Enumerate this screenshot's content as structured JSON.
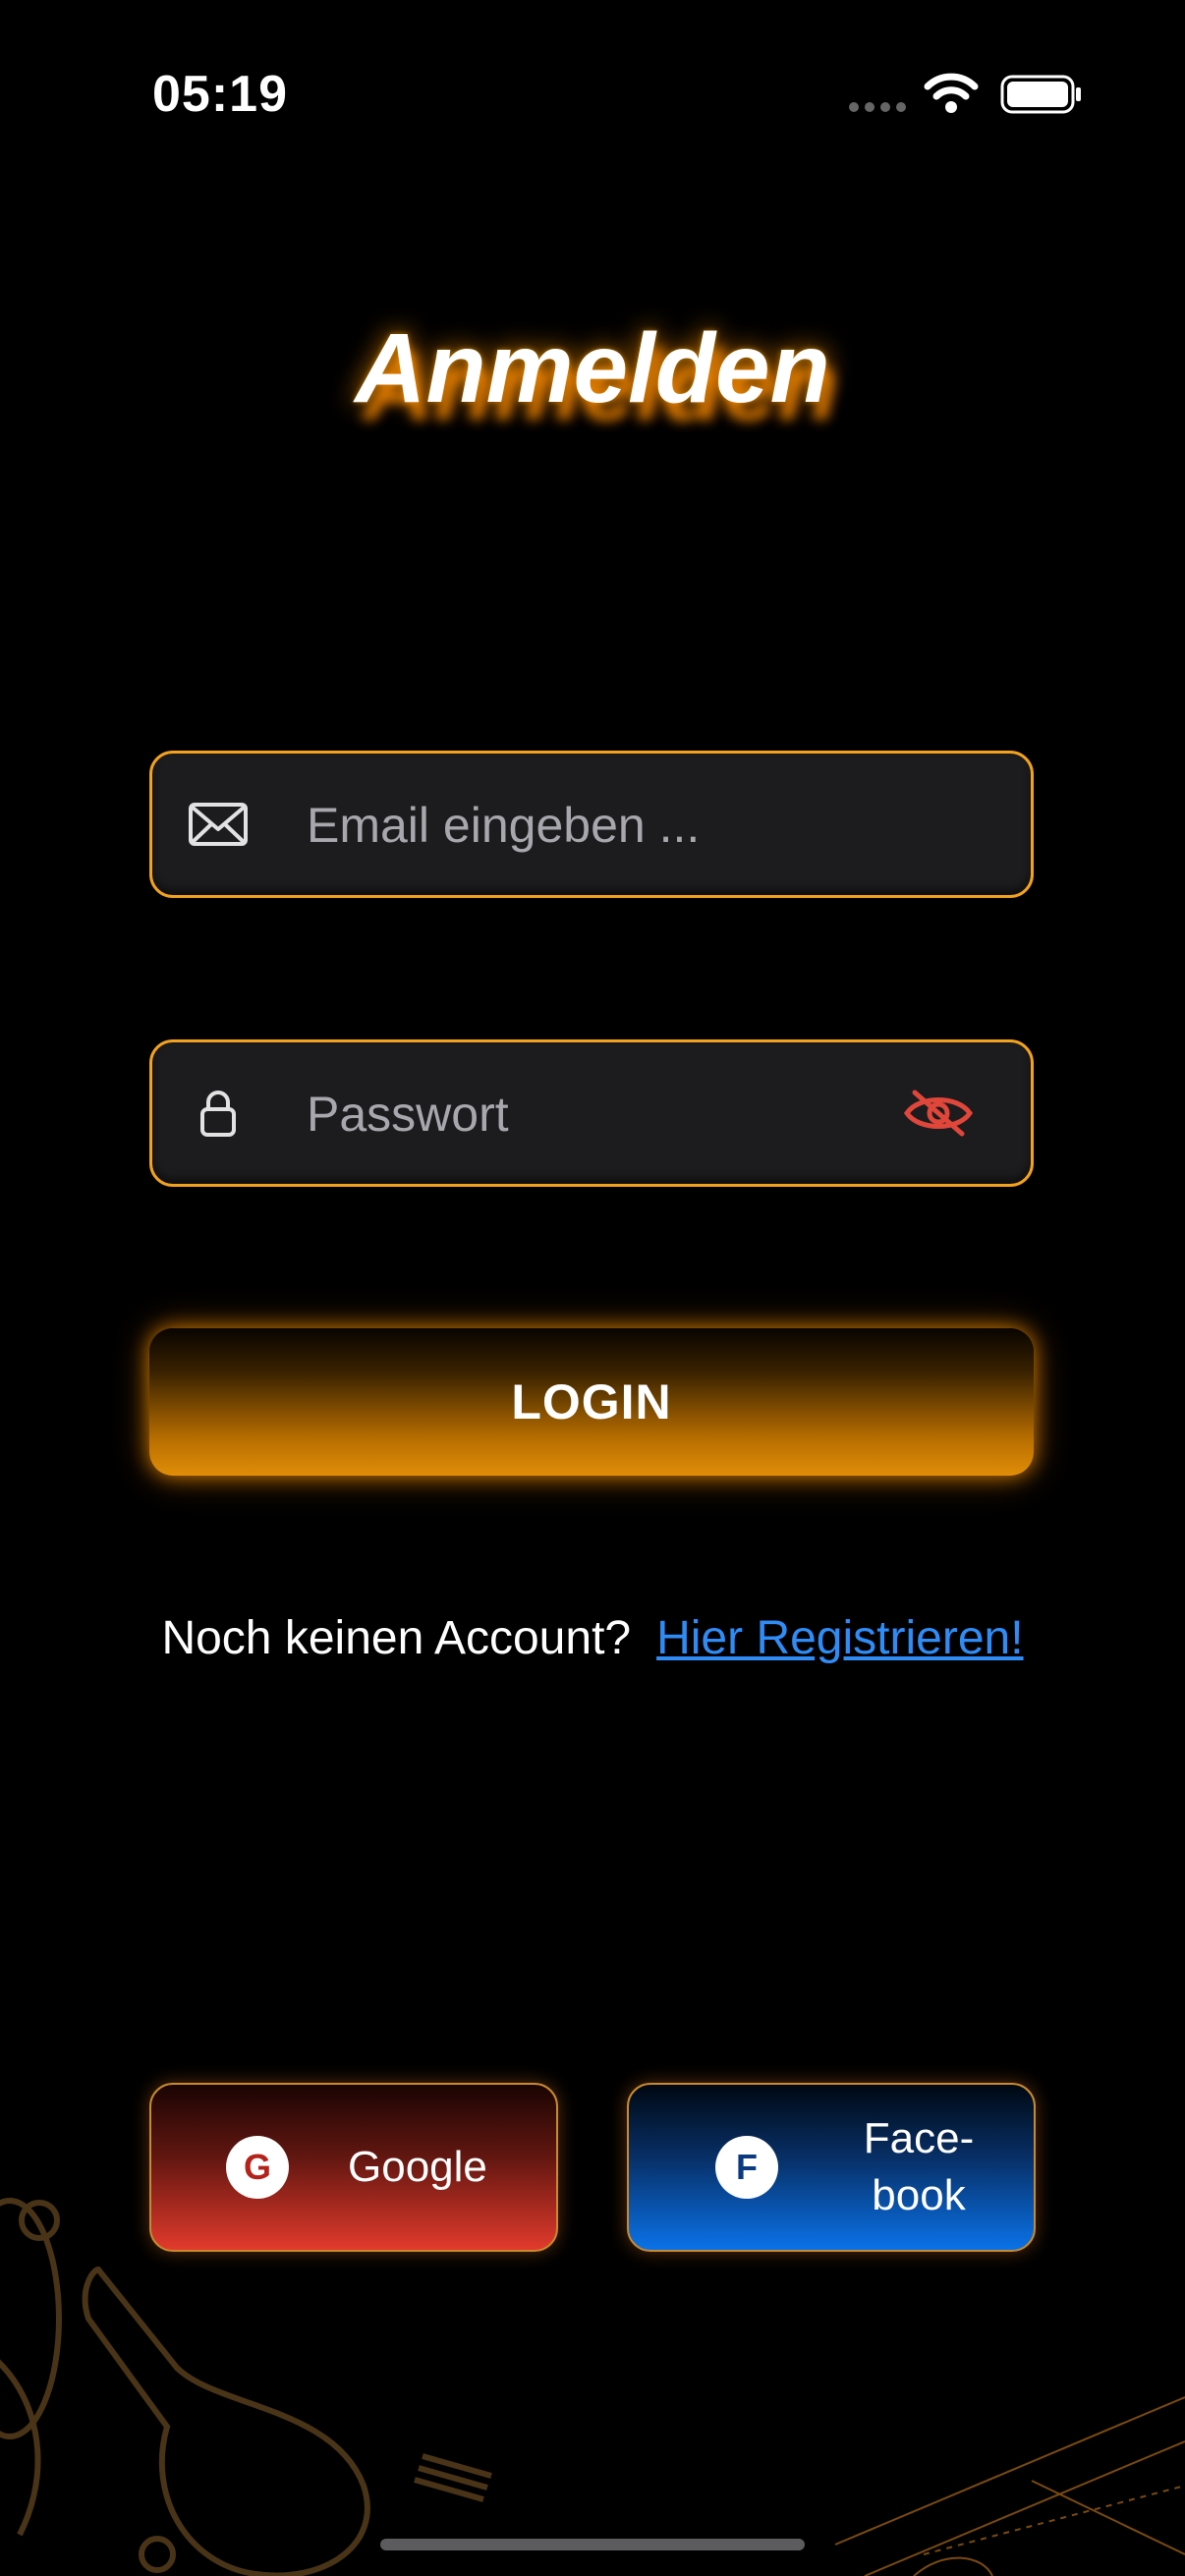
{
  "status_bar": {
    "time": "05:19"
  },
  "screen": {
    "title": "Anmelden"
  },
  "email_field": {
    "placeholder": "Email eingeben ...",
    "value": ""
  },
  "password_field": {
    "placeholder": "Passwort",
    "value": ""
  },
  "login_button": {
    "label": "LOGIN"
  },
  "register": {
    "prompt": "Noch keinen Account?",
    "link_label": "Hier Registrieren!"
  },
  "social": {
    "google": {
      "letter": "G",
      "label": "Google"
    },
    "facebook": {
      "letter": "F",
      "label_line1": "Face-",
      "label_line2": "book"
    }
  },
  "icons": [
    "mail-icon",
    "lock-icon",
    "eye-slash-icon",
    "wifi-icon",
    "battery-icon"
  ],
  "colors": {
    "accent": "#f4a21d",
    "link": "#2f8cf7",
    "eye_icon": "#e0463a",
    "background": "#000000"
  }
}
